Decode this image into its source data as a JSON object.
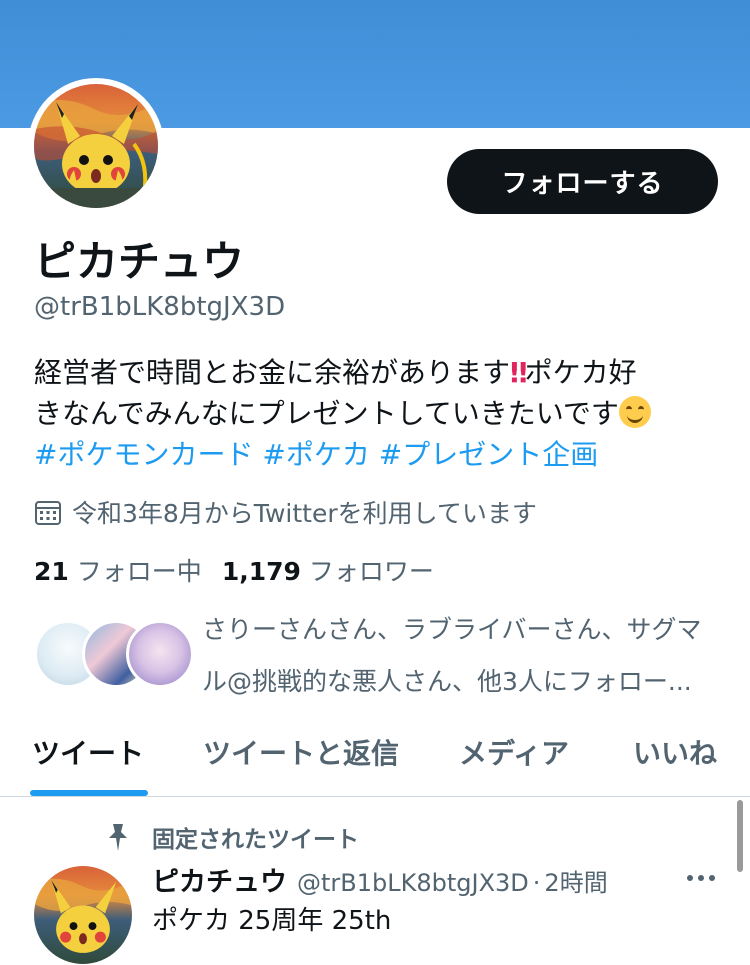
{
  "profile": {
    "display_name": "ピカチュウ",
    "handle": "@trB1bLK8btgJX3D",
    "follow_button_label": "フォローする",
    "bio": {
      "line1_text": "経営者で時間とお金に余裕があります",
      "line1_emoji": "‼",
      "line1_after": "ポケカ好",
      "line2_text": "きなんでみんなにプレゼントしていきたいです",
      "hashtags": [
        "#ポケモンカード",
        "#ポケカ",
        "#プレゼント企画"
      ]
    },
    "joined_text": "令和3年8月からTwitterを利用しています",
    "following_count": "21",
    "following_label": "フォロー中",
    "followers_count": "1,179",
    "followers_label": "フォロワー",
    "followed_by_line1": "さりーさんさん、ラブライバーさん、サグマ",
    "followed_by_line2": "ル@挑戦的な悪人さん、他3人にフォロー..."
  },
  "tabs": [
    {
      "label": "ツイート",
      "active": true
    },
    {
      "label": "ツイートと返信",
      "active": false
    },
    {
      "label": "メディア",
      "active": false
    },
    {
      "label": "いいね",
      "active": false
    }
  ],
  "pinned_tweet": {
    "pinned_label": "固定されたツイート",
    "author_name": "ピカチュウ",
    "author_handle": "@trB1bLK8btgJX3D",
    "separator": "·",
    "time": "2時間",
    "text": "ポケカ 25周年 25th"
  },
  "colors": {
    "banner": "#4b9ae3",
    "accent": "#1d9bf0",
    "follow_button": "#0f1419",
    "secondary_text": "#536471"
  },
  "icons": {
    "calendar": "calendar-icon",
    "pin": "pin-icon",
    "more": "more-icon"
  }
}
